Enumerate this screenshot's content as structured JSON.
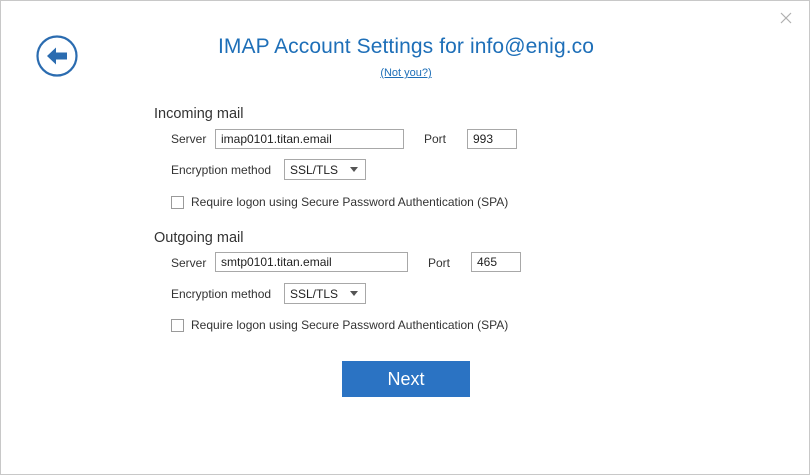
{
  "window": {
    "close_symbol": "✕"
  },
  "header": {
    "back_icon": "arrow-left-circle-icon",
    "title": "IMAP Account Settings for info@enig.co",
    "not_you_link": "(Not you?)"
  },
  "incoming": {
    "section_title": "Incoming mail",
    "server_label": "Server",
    "server_value": "imap0101.titan.email",
    "port_label": "Port",
    "port_value": "993",
    "encryption_label": "Encryption method",
    "encryption_value": "SSL/TLS",
    "spa_label": "Require logon using Secure Password Authentication (SPA)",
    "spa_checked": false
  },
  "outgoing": {
    "section_title": "Outgoing mail",
    "server_label": "Server",
    "server_value": "smtp0101.titan.email",
    "port_label": "Port",
    "port_value": "465",
    "encryption_label": "Encryption method",
    "encryption_value": "SSL/TLS",
    "spa_label": "Require logon using Secure Password Authentication (SPA)",
    "spa_checked": false
  },
  "actions": {
    "next_label": "Next"
  },
  "colors": {
    "accent": "#1e6fb8",
    "button": "#2b73c3"
  }
}
